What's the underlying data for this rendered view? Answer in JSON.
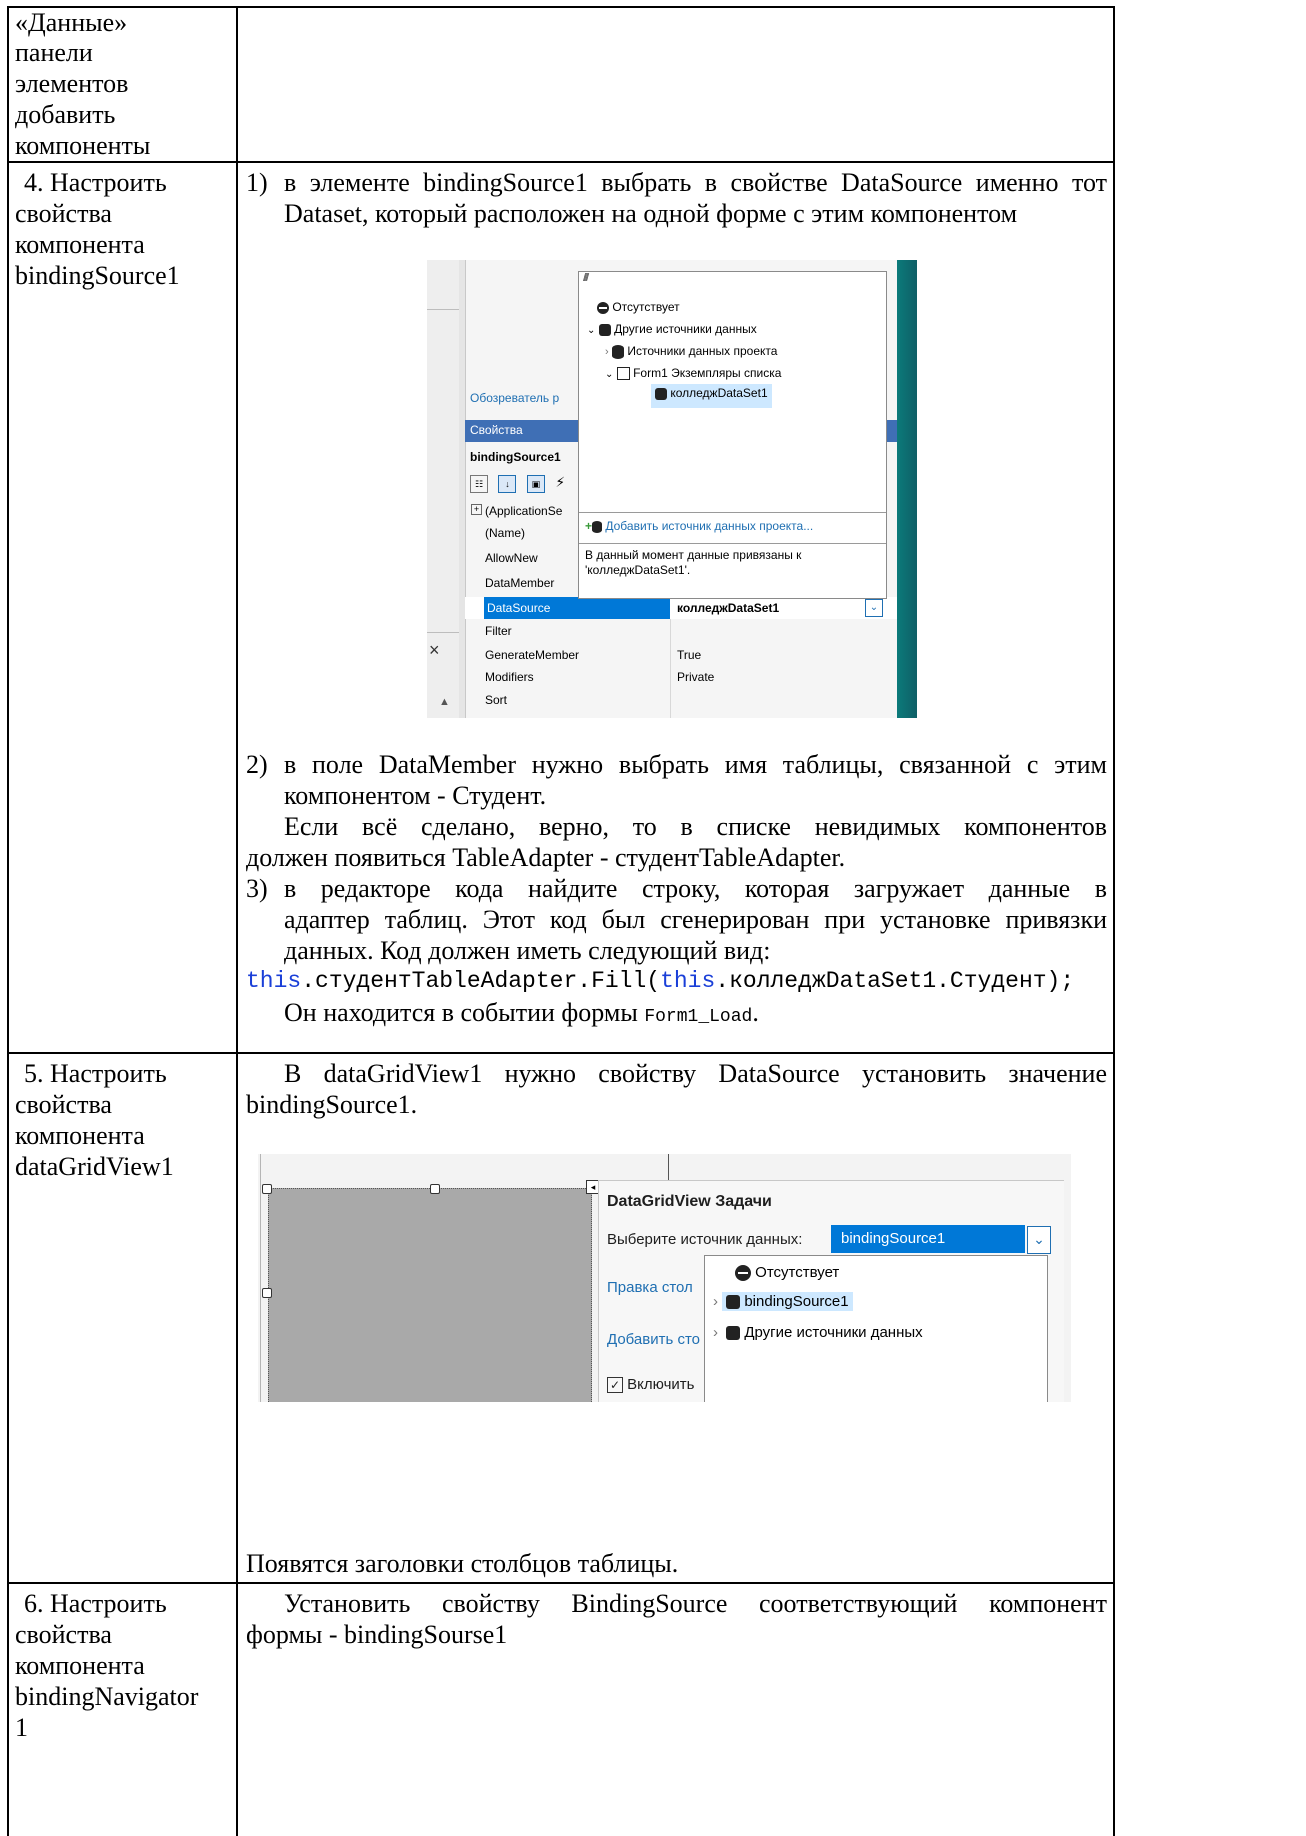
{
  "rows": [
    {
      "left": [
        "«Данные»",
        "панели",
        "элементов",
        "добавить",
        "компоненты"
      ],
      "right": []
    },
    {
      "left": [
        "4. Настроить",
        "свойства",
        "компонента",
        "bindingSource1"
      ],
      "right": {
        "p1_num": "1)",
        "p1_line1": "в элементе bindingSource1 выбрать в свойстве DataSource именно тот",
        "p1_line2": "Dataset, который расположен на одной форме с этим компонентом",
        "p2_num": "2)",
        "p2_line1": "в поле DataMember нужно выбрать имя таблицы, связанной с этим",
        "p2_line2": "компонентом - Студент.",
        "p2_line3": "Если всё сделано, верно, то в списке невидимых компонентов",
        "p2_line4": "должен появиться TableAdapter - студентTableAdapter.",
        "p3_num": "3)",
        "p3_line1": "в редакторе кода найдите строку, которая загружает данные в",
        "p3_line2": "адаптер таблиц. Этот код был сгенерирован при установке привязки",
        "p3_line3": "данных. Код должен иметь следующий вид:",
        "code_kw1": "this",
        "code_mid": ".студентTableAdapter.Fill(",
        "code_kw2": "this",
        "code_end": ".колледжDataSet1.Студент);",
        "p4_text": "Он находится в событии формы ",
        "p4_code": "Form1_Load",
        "p4_end": "."
      }
    },
    {
      "left": [
        "5. Настроить",
        "свойства",
        "компонента",
        "dataGridView1"
      ],
      "right": {
        "line1": "В dataGridView1 нужно свойству DataSource установить значение",
        "line2": "bindingSource1.",
        "line3": "Появятся заголовки столбцов таблицы."
      }
    },
    {
      "left": [
        "6. Настроить",
        "свойства",
        "компонента",
        "bindingNavigator",
        "1"
      ],
      "right": {
        "line1": "Установить свойству BindingSource соответствующий компонент",
        "line2": "формы - bindingSourse1"
      }
    }
  ],
  "screenshot1": {
    "dropdown_items": [
      "Отсутствует",
      "Другие источники данных",
      "Источники данных проекта",
      "Form1 Экземпляры списка",
      "колледжDataSet1"
    ],
    "add_source": "Добавить источник данных проекта...",
    "hint_line1": "В данный момент данные привязаны к",
    "hint_line2": "'колледжDataSet1'.",
    "explorer_label": "Обозреватель р",
    "panel_title": "Свойства",
    "object_name": "bindingSource1",
    "props": [
      {
        "name": "(ApplicationSe",
        "value": ""
      },
      {
        "name": "(Name)",
        "value": ""
      },
      {
        "name": "AllowNew",
        "value": ""
      },
      {
        "name": "DataMember",
        "value": ""
      },
      {
        "name": "DataSource",
        "value": "колледжDataSet1"
      },
      {
        "name": "Filter",
        "value": ""
      },
      {
        "name": "GenerateMember",
        "value": "True"
      },
      {
        "name": "Modifiers",
        "value": "Private"
      },
      {
        "name": "Sort",
        "value": ""
      }
    ]
  },
  "screenshot2": {
    "title": "DataGridView Задачи",
    "choose_label": "Выберите источник данных:",
    "choose_value": "bindingSource1",
    "links": [
      "Правка стол",
      "Добавить сто"
    ],
    "checkbox_label": "Включить",
    "items": [
      "Отсутствует",
      "bindingSource1",
      "Другие источники данных"
    ]
  },
  "colors": {
    "select_blue": "#0078d7",
    "link_blue": "#1f6fb2",
    "code_blue": "#1a3fd8",
    "teal": "#0b7a7a",
    "header_blue": "#3f6fb5"
  }
}
